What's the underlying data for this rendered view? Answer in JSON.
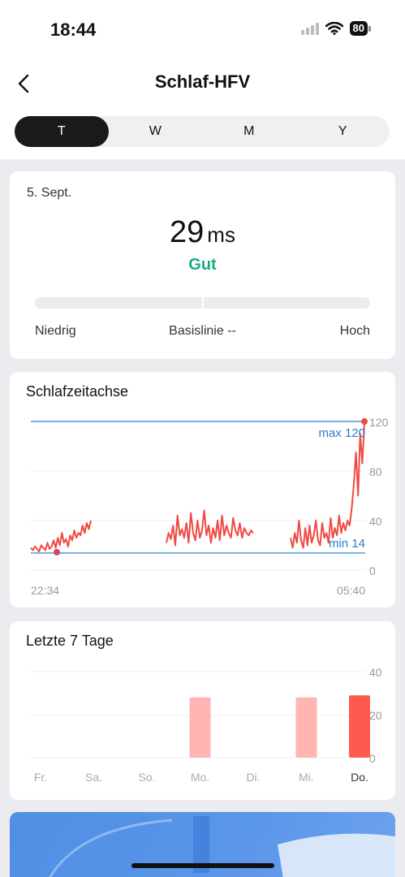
{
  "status": {
    "time": "18:44",
    "battery": "80"
  },
  "header": {
    "title": "Schlaf-HFV"
  },
  "tabs": [
    "T",
    "W",
    "M",
    "Y"
  ],
  "summary": {
    "date": "5. Sept.",
    "value": "29",
    "unit": "ms",
    "quality": "Gut",
    "low_label": "Niedrig",
    "baseline_label": "Basislinie --",
    "high_label": "Hoch"
  },
  "timeline": {
    "title": "Schlafzeitachse",
    "start_time": "22:34",
    "end_time": "05:40",
    "max_label": "max 120",
    "min_label": "min 14",
    "y_ticks": [
      "120",
      "80",
      "40",
      "0"
    ]
  },
  "week": {
    "title": "Letzte 7 Tage",
    "y_ticks": [
      "40",
      "20",
      "0"
    ]
  },
  "colors": {
    "accent_green": "#1aab86",
    "line_red": "#f04a44",
    "ref_blue": "#4a90d9",
    "bar_light": "#ffb5b2",
    "bar_dark": "#ff5a50"
  },
  "chart_data": [
    {
      "type": "line",
      "title": "Schlafzeitachse",
      "x_range": [
        "22:34",
        "05:40"
      ],
      "ylim": [
        0,
        120
      ],
      "y_ticks": [
        0,
        40,
        80,
        120
      ],
      "segments": [
        {
          "values": [
            18,
            16,
            19,
            17,
            15,
            20,
            18,
            16,
            22,
            17,
            19,
            24,
            18,
            26,
            20,
            30,
            22,
            25,
            19,
            28,
            24,
            32,
            26,
            30,
            28,
            36,
            30,
            38,
            33,
            40
          ]
        },
        {
          "values": [
            22,
            30,
            25,
            36,
            20,
            44,
            28,
            33,
            26,
            38,
            22,
            46,
            30,
            24,
            40,
            26,
            32,
            48,
            28,
            36,
            22,
            34,
            26,
            40,
            24,
            44,
            28,
            36,
            30,
            26,
            42,
            32,
            28,
            38,
            26,
            34,
            30,
            28,
            32,
            30
          ]
        },
        {
          "values": [
            26,
            18,
            30,
            22,
            40,
            24,
            18,
            34,
            20,
            36,
            22,
            28,
            40,
            24,
            20,
            38,
            26,
            30,
            22,
            42,
            26,
            34,
            28,
            44,
            30,
            38,
            32,
            40,
            36,
            50,
            70,
            95,
            60,
            110,
            86,
            120
          ]
        }
      ],
      "max": 120,
      "min": 14
    },
    {
      "type": "bar",
      "title": "Letzte 7 Tage",
      "categories": [
        "Fr.",
        "Sa.",
        "So.",
        "Mo.",
        "Di.",
        "Mi.",
        "Do."
      ],
      "values": [
        null,
        null,
        null,
        28,
        null,
        28,
        29
      ],
      "ylim": [
        0,
        40
      ],
      "y_ticks": [
        0,
        20,
        40
      ]
    }
  ]
}
